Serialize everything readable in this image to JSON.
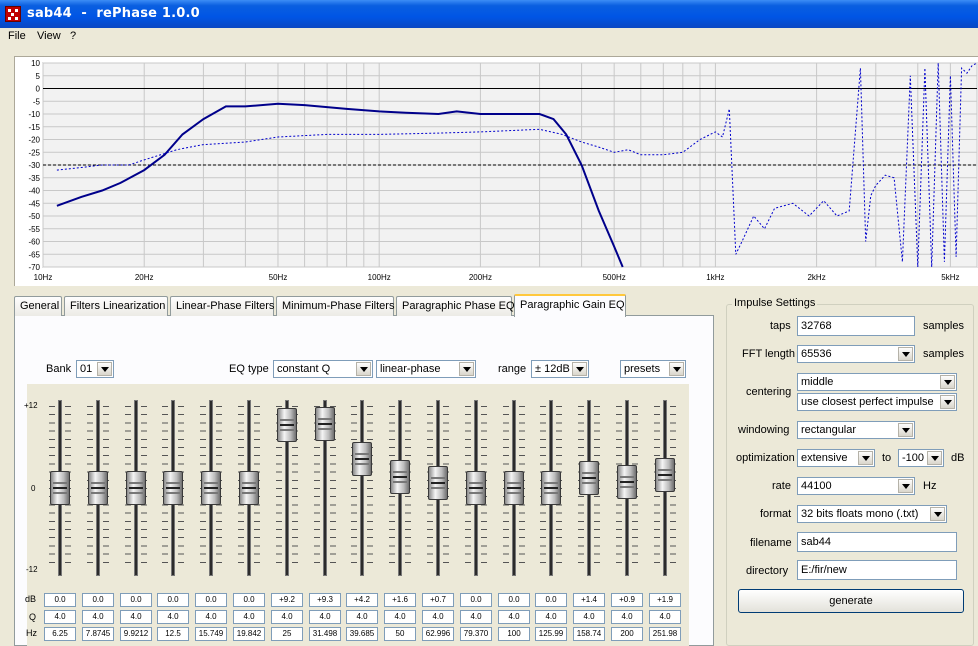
{
  "window": {
    "title": "sab44  -  rePhase 1.0.0"
  },
  "menu": [
    "File",
    "View",
    "?"
  ],
  "chart_data": {
    "type": "line",
    "xscale": "log",
    "xlim": [
      10,
      6000
    ],
    "ylim": [
      -70,
      10
    ],
    "grid": true,
    "y_ticks": [
      "10",
      "5",
      "0",
      "-5",
      "-10",
      "-15",
      "-20",
      "-25",
      "-30",
      "-35",
      "-40",
      "-45",
      "-50",
      "-55",
      "-60",
      "-65",
      "-70"
    ],
    "x_ticks": [
      {
        "v": 10,
        "label": "10Hz"
      },
      {
        "v": 20,
        "label": "20Hz"
      },
      {
        "v": 50,
        "label": "50Hz"
      },
      {
        "v": 100,
        "label": "100Hz"
      },
      {
        "v": 200,
        "label": "200Hz"
      },
      {
        "v": 500,
        "label": "500Hz"
      },
      {
        "v": 1000,
        "label": "1kHz"
      },
      {
        "v": 2000,
        "label": "2kHz"
      },
      {
        "v": 5000,
        "label": "5kHz"
      }
    ],
    "reference_level": -30,
    "series": [
      {
        "style": "solid",
        "color": "#00008b",
        "x": [
          11,
          13,
          15,
          17,
          20,
          23,
          26,
          30,
          35,
          40,
          50,
          60,
          80,
          100,
          120,
          150,
          170,
          200,
          250,
          300,
          330,
          360,
          400,
          450,
          500,
          530
        ],
        "y": [
          -46,
          -42.5,
          -40,
          -37,
          -32,
          -26,
          -18,
          -12,
          -7,
          -7,
          -6,
          -6.5,
          -8,
          -9,
          -9.5,
          -10,
          -9,
          -10,
          -10,
          -10,
          -12,
          -18,
          -30,
          -48,
          -62,
          -70
        ]
      },
      {
        "style": "dashed",
        "color": "#0000cc",
        "x": [
          11,
          13,
          15,
          18,
          20,
          25,
          30,
          40,
          50,
          70,
          100,
          150,
          200,
          300,
          350,
          400,
          450,
          500,
          550,
          600,
          700,
          800,
          900,
          1000,
          1050,
          1100,
          1150,
          1200,
          1300,
          1400,
          1500,
          1700,
          1900,
          2100,
          2300,
          2500,
          2700,
          2800,
          2900,
          3000,
          3200,
          3400,
          3600,
          3800,
          4000,
          4200,
          4400,
          4600,
          4800,
          5000,
          5200,
          5400,
          5600,
          5800,
          6000
        ],
        "y": [
          -32,
          -31,
          -30,
          -30,
          -28,
          -24,
          -22,
          -21,
          -19,
          -18,
          -18,
          -17.5,
          -17,
          -16,
          -18,
          -21,
          -23,
          -25,
          -24,
          -26,
          -26,
          -25,
          -20,
          -17,
          -19,
          -8,
          -65,
          -60,
          -50,
          -55,
          -47,
          -45,
          -50,
          -44,
          -50,
          -48,
          8,
          -60,
          -42,
          -38,
          -34,
          -35,
          -68,
          5,
          -70,
          8,
          -70,
          10,
          -68,
          5,
          -66,
          8,
          6,
          9,
          10
        ]
      }
    ]
  },
  "tabs": [
    {
      "label": "General"
    },
    {
      "label": "Filters Linearization"
    },
    {
      "label": "Linear-Phase Filters"
    },
    {
      "label": "Minimum-Phase Filters"
    },
    {
      "label": "Paragraphic Phase EQ"
    },
    {
      "label": "Paragraphic Gain EQ"
    }
  ],
  "eq": {
    "bank_label": "Bank",
    "bank_value": "01",
    "eq_type_label": "EQ type",
    "eq_type_value": "constant Q",
    "phase_mode_value": "linear-phase",
    "range_label": "range",
    "range_value": "± 12dB",
    "presets_label": "presets",
    "scale_top": "+12",
    "scale_mid": "0",
    "scale_bottom": "-12",
    "row_labels": {
      "db": "dB",
      "q": "Q",
      "hz": "Hz"
    },
    "bands": [
      {
        "db": "0.0",
        "q": "4.0",
        "hz": "6.25",
        "level": 0.0
      },
      {
        "db": "0.0",
        "q": "4.0",
        "hz": "7.8745",
        "level": 0.0
      },
      {
        "db": "0.0",
        "q": "4.0",
        "hz": "9.9212",
        "level": 0.0
      },
      {
        "db": "0.0",
        "q": "4.0",
        "hz": "12.5",
        "level": 0.0
      },
      {
        "db": "0.0",
        "q": "4.0",
        "hz": "15.749",
        "level": 0.0
      },
      {
        "db": "0.0",
        "q": "4.0",
        "hz": "19.842",
        "level": 0.0
      },
      {
        "db": "+9.2",
        "q": "4.0",
        "hz": "25",
        "level": 9.2
      },
      {
        "db": "+9.3",
        "q": "4.0",
        "hz": "31.498",
        "level": 9.3
      },
      {
        "db": "+4.2",
        "q": "4.0",
        "hz": "39.685",
        "level": 4.2
      },
      {
        "db": "+1.6",
        "q": "4.0",
        "hz": "50",
        "level": 1.6
      },
      {
        "db": "+0.7",
        "q": "4.0",
        "hz": "62.996",
        "level": 0.7
      },
      {
        "db": "0.0",
        "q": "4.0",
        "hz": "79.370",
        "level": 0.0
      },
      {
        "db": "0.0",
        "q": "4.0",
        "hz": "100",
        "level": 0.0
      },
      {
        "db": "0.0",
        "q": "4.0",
        "hz": "125.99",
        "level": 0.0
      },
      {
        "db": "+1.4",
        "q": "4.0",
        "hz": "158.74",
        "level": 1.4
      },
      {
        "db": "+0.9",
        "q": "4.0",
        "hz": "200",
        "level": 0.9
      },
      {
        "db": "+1.9",
        "q": "4.0",
        "hz": "251.98",
        "level": 1.9
      }
    ]
  },
  "impulse": {
    "group_title": "Impulse Settings",
    "taps_label": "taps",
    "taps_value": "32768",
    "taps_unit": "samples",
    "fft_label": "FFT length",
    "fft_value": "65536",
    "fft_unit": "samples",
    "centering_label": "centering",
    "centering_value": "middle",
    "centering_mode": "use closest perfect impulse",
    "windowing_label": "windowing",
    "windowing_value": "rectangular",
    "optimization_label": "optimization",
    "optimization_value": "extensive",
    "to_label": "to",
    "optimization_limit": "-100",
    "db_unit": "dB",
    "rate_label": "rate",
    "rate_value": "44100",
    "rate_unit": "Hz",
    "format_label": "format",
    "format_value": "32 bits floats mono (.txt)",
    "filename_label": "filename",
    "filename_value": "sab44",
    "directory_label": "directory",
    "directory_value": "E:/fir/new",
    "generate_label": "generate"
  }
}
